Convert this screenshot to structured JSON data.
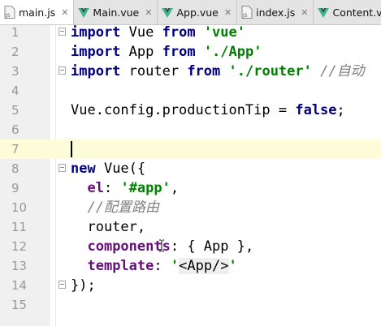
{
  "tabs": [
    {
      "label": "main.js",
      "type": "js",
      "active": true
    },
    {
      "label": "Main.vue",
      "type": "vue",
      "active": false
    },
    {
      "label": "App.vue",
      "type": "vue",
      "active": false
    },
    {
      "label": "index.js",
      "type": "js",
      "active": false
    },
    {
      "label": "Content.vu",
      "type": "vue",
      "active": false
    }
  ],
  "icons": {
    "js_file": "js-file-icon",
    "vue_file": "vue-file-icon",
    "close": "close-icon",
    "fold": "fold-icon"
  },
  "colors": {
    "current_line": "#fcfcd9",
    "keyword": "#000080",
    "string": "#008000",
    "comment": "#808080",
    "property": "#660e7a"
  },
  "current_line": 7,
  "lines": [
    {
      "n": "1",
      "t": {
        "a": "import",
        "b": " Vue ",
        "c": "from",
        "d": " ",
        "e": "'vue'"
      }
    },
    {
      "n": "2",
      "t": {
        "a": "import",
        "b": " App ",
        "c": "from",
        "d": " ",
        "e": "'./App'"
      }
    },
    {
      "n": "3",
      "t": {
        "a": "import",
        "b": " router ",
        "c": "from",
        "d": " ",
        "e": "'./router'",
        "f": " //自动"
      }
    },
    {
      "n": "4"
    },
    {
      "n": "5",
      "t": {
        "a": "Vue.config.productionTip = ",
        "b": "false",
        "c": ";"
      }
    },
    {
      "n": "6"
    },
    {
      "n": "7"
    },
    {
      "n": "8",
      "t": {
        "a": "new",
        "b": " Vue({"
      }
    },
    {
      "n": "9",
      "t": {
        "a": "  ",
        "b": "el",
        "c": ": ",
        "d": "'#app'",
        "e": ","
      }
    },
    {
      "n": "10",
      "t": {
        "a": "  ",
        "b": "//配置路由"
      }
    },
    {
      "n": "11",
      "t": {
        "a": "  router,"
      }
    },
    {
      "n": "12",
      "t": {
        "a": "  ",
        "b": "components",
        "c": ": { App },"
      }
    },
    {
      "n": "13",
      "t": {
        "a": "  ",
        "b": "template",
        "c": ": ",
        "d": "'",
        "e": "<App/>",
        "f": "'"
      }
    },
    {
      "n": "14",
      "t": {
        "a": "});"
      }
    },
    {
      "n": "15"
    }
  ]
}
